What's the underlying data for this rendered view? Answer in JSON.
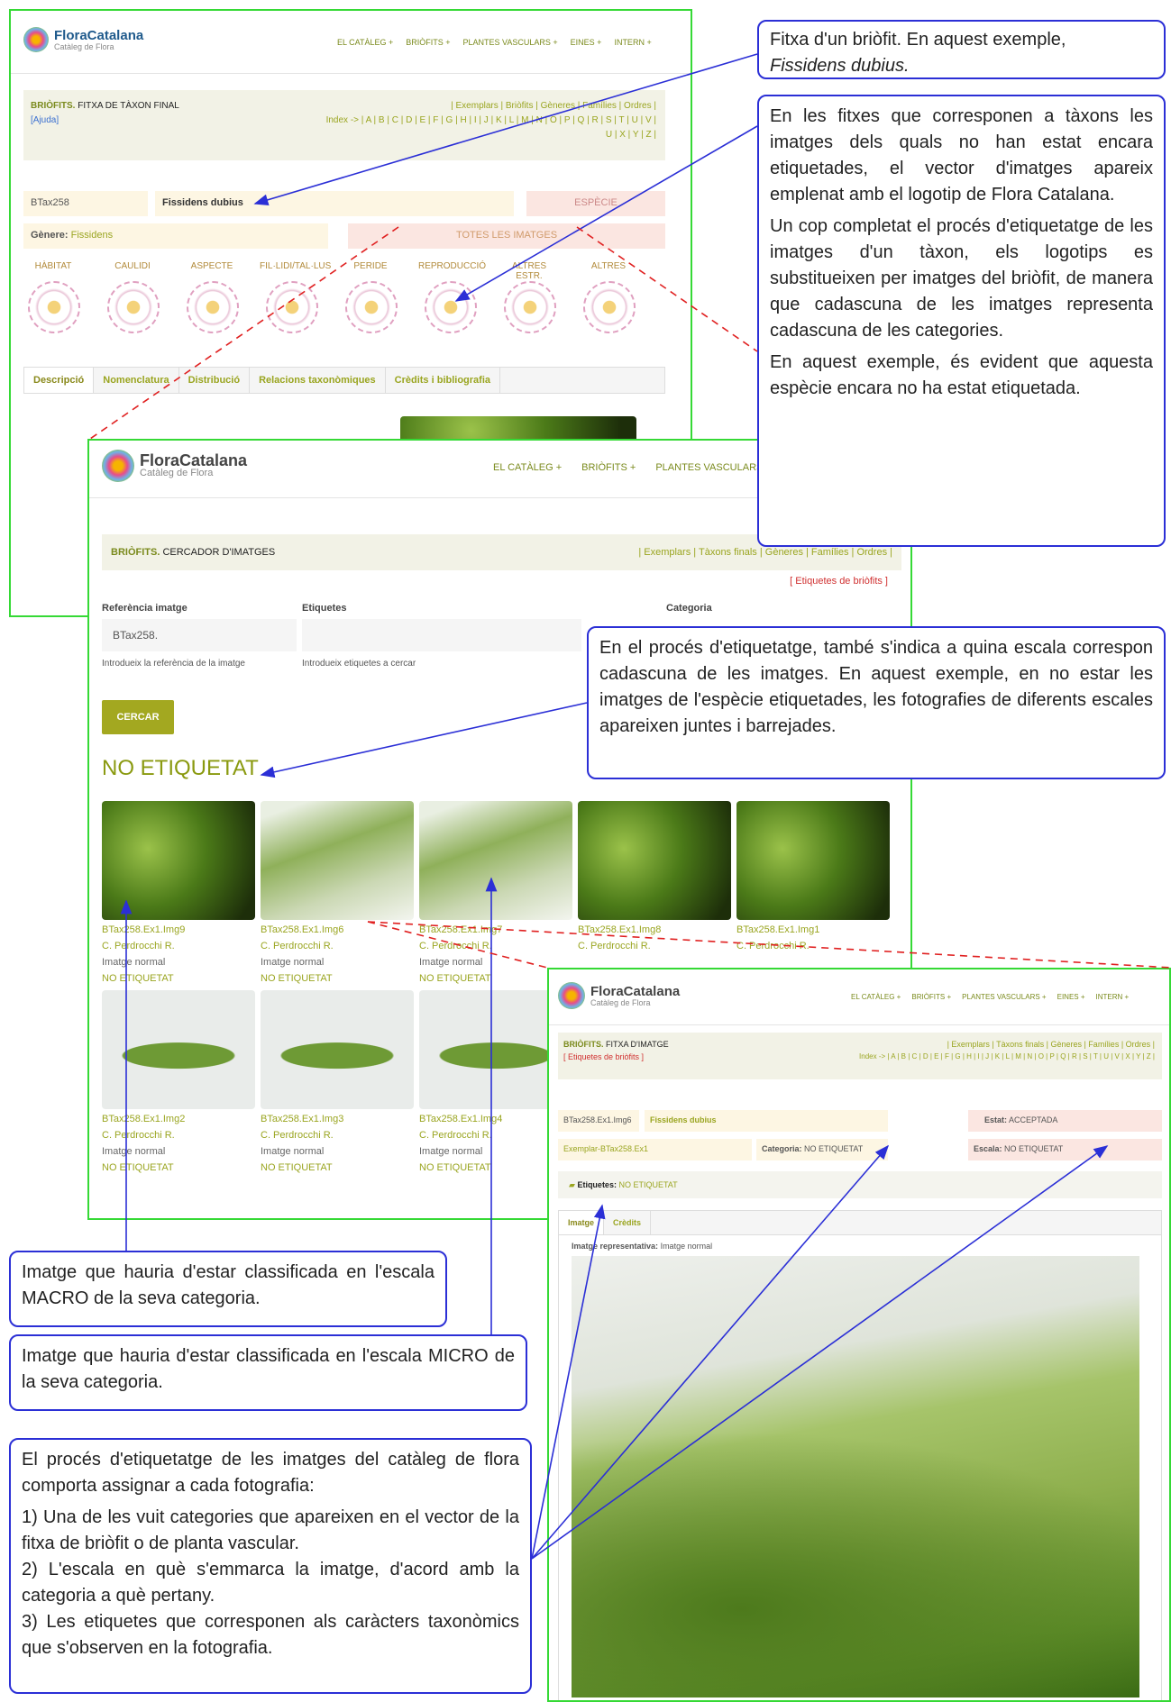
{
  "brand": {
    "name": "FloraCatalana",
    "tagline": "Catàleg de Flora"
  },
  "s1": {
    "nav": [
      "EL CATÀLEG +",
      "BRIÒFITS +",
      "PLANTES VASCULARS +",
      "EINES +",
      "INTERN +"
    ],
    "section_bold": "BRIÒFITS.",
    "section": "FITXA DE TÀXON FINAL",
    "help": "[Ajuda]",
    "links": "| Exemplars | Briòfits | Gèneres | Famílies | Ordres |",
    "index": "Index -> | A | B | C | D | E | F | G | H | I | J | K | L | M | N | O | P | Q | R | S | T | U | V |",
    "index2": "U | X | Y | Z |",
    "code": "BTax258",
    "taxon": "Fissidens dubius",
    "rank": "ESPÈCIE",
    "genus_label": "Gènere:",
    "genus": "Fissidens",
    "all_images": "TOTES LES IMATGES",
    "categories": [
      "HÀBITAT",
      "CAULIDI",
      "ASPECTE",
      "FIL·LIDI/TAL·LUS",
      "PERIDE",
      "REPRODUCCIÓ",
      "ALTRES ESTR.",
      "ALTRES"
    ],
    "tabs": [
      "Descripció",
      "Nomenclatura",
      "Distribució",
      "Relacions taxonòmiques",
      "Crèdits i bibliografia"
    ]
  },
  "s2": {
    "nav": [
      "EL CATÀLEG +",
      "BRIÒFITS +",
      "PLANTES VASCULARS"
    ],
    "section_bold": "BRIÒFITS.",
    "section": "CERCADOR D'IMATGES",
    "links": "| Exemplars | Tàxons finals | Gèneres | Famílies | Ordres |",
    "tag_link": "[ Etiquetes de briòfits ]",
    "ref_label": "Referència imatge",
    "ref_value": "BTax258.",
    "ref_hint": "Introdueix la referència de la imatge",
    "tags_label": "Etiquetes",
    "tags_hint": "Introdueix etiquetes a cercar",
    "cat_label": "Categoria",
    "search": "CERCAR",
    "heading": "NO ETIQUETAT",
    "images": [
      {
        "id": "BTax258.Ex1.Img9",
        "author": "C. Perdrocchi R.",
        "type": "Imatge normal",
        "state": "NO ETIQUETAT",
        "kind": "moss"
      },
      {
        "id": "BTax258.Ex1.Img6",
        "author": "C. Perdrocchi R.",
        "type": "Imatge normal",
        "state": "NO ETIQUETAT",
        "kind": "leafp"
      },
      {
        "id": "BTax258.Ex1.Img7",
        "author": "C. Perdrocchi R.",
        "type": "Imatge normal",
        "state": "NO ETIQUETAT",
        "kind": "leafp"
      },
      {
        "id": "BTax258.Ex1.Img8",
        "author": "C. Perdrocchi R.",
        "type": "",
        "state": "",
        "kind": "moss"
      },
      {
        "id": "BTax258.Ex1.Img1",
        "author": "C. Perdrocchi R.",
        "type": "",
        "state": "",
        "kind": "moss"
      },
      {
        "id": "BTax258.Ex1.Img2",
        "author": "C. Perdrocchi R.",
        "type": "Imatge normal",
        "state": "NO ETIQUETAT",
        "kind": "leafw"
      },
      {
        "id": "BTax258.Ex1.Img3",
        "author": "C. Perdrocchi R.",
        "type": "Imatge normal",
        "state": "NO ETIQUETAT",
        "kind": "leafw"
      },
      {
        "id": "BTax258.Ex1.Img4",
        "author": "C. Perdrocchi R.",
        "type": "Imatge normal",
        "state": "NO ETIQUETAT",
        "kind": "leafw"
      }
    ]
  },
  "s3": {
    "nav": [
      "EL CATÀLEG +",
      "BRIÒFITS +",
      "PLANTES VASCULARS +",
      "EINES +",
      "INTERN +"
    ],
    "section_bold": "BRIÒFITS.",
    "section": "FITXA D'IMATGE",
    "tag_link": "[ Etiquetes de briòfits ]",
    "links": "| Exemplars | Tàxons finals | Gèneres | Famílies | Ordres |",
    "index": "Index -> | A | B | C | D | E | F | G | H | I | J | K | L | M | N | O | P | Q | R | S | T | U | V | X | Y | Z |",
    "img_id": "BTax258.Ex1.Img6",
    "taxon": "Fissidens dubius",
    "state_label": "Estat:",
    "state": "ACCEPTADA",
    "exemplar": "Exemplar-BTax258.Ex1",
    "cat_label": "Categoria:",
    "cat": "NO ETIQUETAT",
    "scale_label": "Escala:",
    "scale": "NO ETIQUETAT",
    "tags_label": "Etiquetes:",
    "tags": "NO ETIQUETAT",
    "tabs": [
      "Imatge",
      "Crèdits"
    ],
    "rep_label": "Imatge representativa:",
    "rep": "Imatge normal"
  },
  "notes": {
    "n1_a": "Fitxa d'un briòfit. En aquest exemple,",
    "n1_b": "Fissidens dubius.",
    "n2_p1": "En les fitxes que corresponen a tàxons les imatges dels quals no han estat encara etiquetades, el vector d'imatges apareix emplenat amb el logotip de Flora Catalana.",
    "n2_p2": "Un cop completat el procés d'etiquetatge de les imatges d'un tàxon, els logotips es substitueixen per imatges del briòfit, de manera que cadascuna de les imatges representa cadascuna de les categories.",
    "n2_p3": "En aquest exemple, és evident que aquesta espècie encara no ha estat etiquetada.",
    "n3": "En el procés d'etiquetatge, també s'indica a quina escala correspon cadascuna de les imatges. En aquest exemple, en no estar les imatges de l'espècie etiquetades, les fotografies de diferents escales apareixen juntes i barrejades.",
    "n4": "Imatge que hauria d'estar classificada en l'escala MACRO de la seva categoria.",
    "n5": "Imatge que hauria d'estar classificada en l'escala MICRO de la seva categoria.",
    "n6_intro": "El procés d'etiquetatge de les imatges del catàleg de flora comporta assignar a cada fotografia:",
    "n6_1": "1) Una de les vuit categories que apareixen en el vector de la fitxa de briòfit o de planta vascular.",
    "n6_2": "2) L'escala en què s'emmarca la imatge, d'acord amb la categoria a què pertany.",
    "n6_3": "3) Les etiquetes que corresponen als caràcters taxonòmics que s'observen en la fotografia."
  },
  "colors": {
    "frame": "#35d935",
    "callout": "#2b2fd6",
    "dashed": "#e02020",
    "accent": "#9aa520"
  }
}
